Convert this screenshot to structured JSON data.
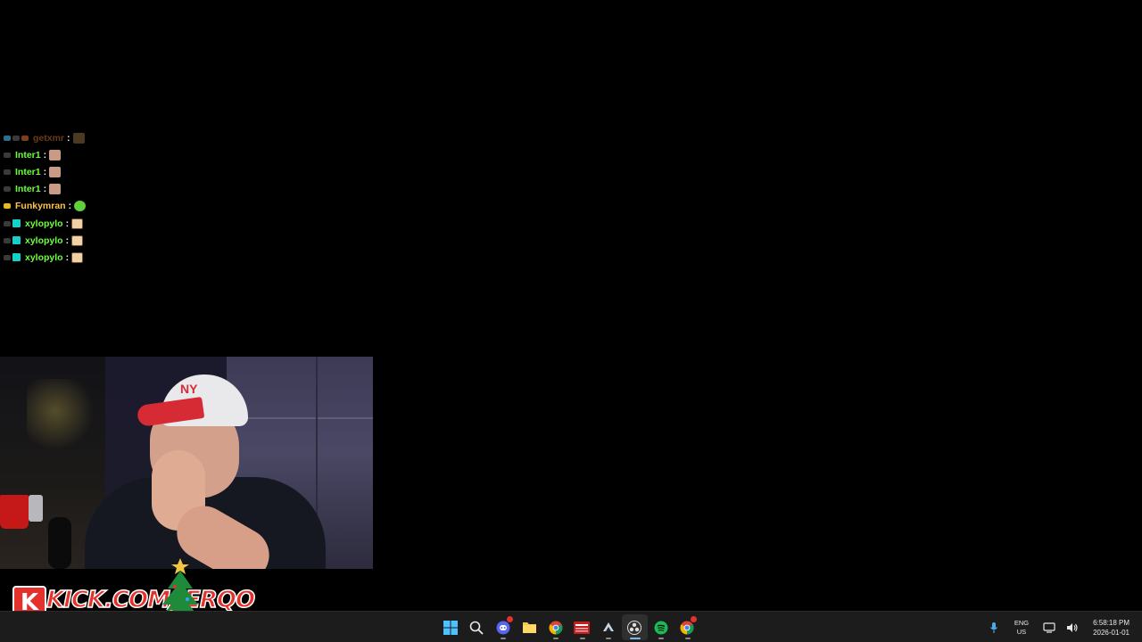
{
  "chat": {
    "messages": [
      {
        "username": "getxmr",
        "color": "#6a3a16",
        "separator": ":",
        "badges": [
          "blue",
          "grey",
          "brown"
        ],
        "emote": "dim"
      },
      {
        "username": "Inter1",
        "color": "#6dff3c",
        "separator": ":",
        "badges": [
          "grey"
        ],
        "emote": "flat"
      },
      {
        "username": "Inter1",
        "color": "#6dff3c",
        "separator": ":",
        "badges": [
          "grey"
        ],
        "emote": "flat"
      },
      {
        "username": "Inter1",
        "color": "#6dff3c",
        "separator": ":",
        "badges": [
          "grey"
        ],
        "emote": "flat"
      },
      {
        "username": "Funkymran",
        "color": "#ffc44d",
        "separator": ":",
        "badges": [
          "gold"
        ],
        "emote": "green"
      },
      {
        "username": "xylopylo",
        "color": "#6dff3c",
        "separator": ":",
        "badges": [
          "grey",
          "cyan"
        ],
        "emote": "ok"
      },
      {
        "username": "xylopylo",
        "color": "#6dff3c",
        "separator": ":",
        "badges": [
          "grey",
          "cyan"
        ],
        "emote": "ok"
      },
      {
        "username": "xylopylo",
        "color": "#6dff3c",
        "separator": ":",
        "badges": [
          "grey",
          "cyan"
        ],
        "emote": "ok"
      }
    ]
  },
  "webcam": {
    "cap_logo": "NY"
  },
  "branding": {
    "k_letter": "K",
    "url": "KICK.COM/JERQO"
  },
  "taskbar": {
    "apps": [
      {
        "name": "start-button",
        "icon": "windows-icon",
        "active": false,
        "running": false
      },
      {
        "name": "search-button",
        "icon": "search-icon",
        "active": false,
        "running": false
      },
      {
        "name": "discord-app",
        "icon": "discord-icon",
        "active": false,
        "running": true,
        "notif": true
      },
      {
        "name": "file-explorer-app",
        "icon": "folder-icon",
        "active": false,
        "running": false
      },
      {
        "name": "chrome-app",
        "icon": "chrome-icon",
        "active": false,
        "running": true
      },
      {
        "name": "voicemeeter-app",
        "icon": "voicemeeter-icon",
        "active": false,
        "running": true
      },
      {
        "name": "steam-app",
        "icon": "steam-icon",
        "active": false,
        "running": true
      },
      {
        "name": "obs-app",
        "icon": "obs-icon",
        "active": true,
        "running": true
      },
      {
        "name": "spotify-app",
        "icon": "spotify-icon",
        "active": false,
        "running": true
      },
      {
        "name": "chrome-profile-app",
        "icon": "chrome-icon",
        "active": false,
        "running": true,
        "notif": true
      }
    ],
    "tray": {
      "lang_top": "ENG",
      "lang_bottom": "US",
      "time": "6:58:18 PM",
      "date": "2026-01-01"
    }
  },
  "colors": {
    "taskbar_bg": "#1c1c1c",
    "kick_red": "#e4312b",
    "accent": "#76b9ed"
  }
}
